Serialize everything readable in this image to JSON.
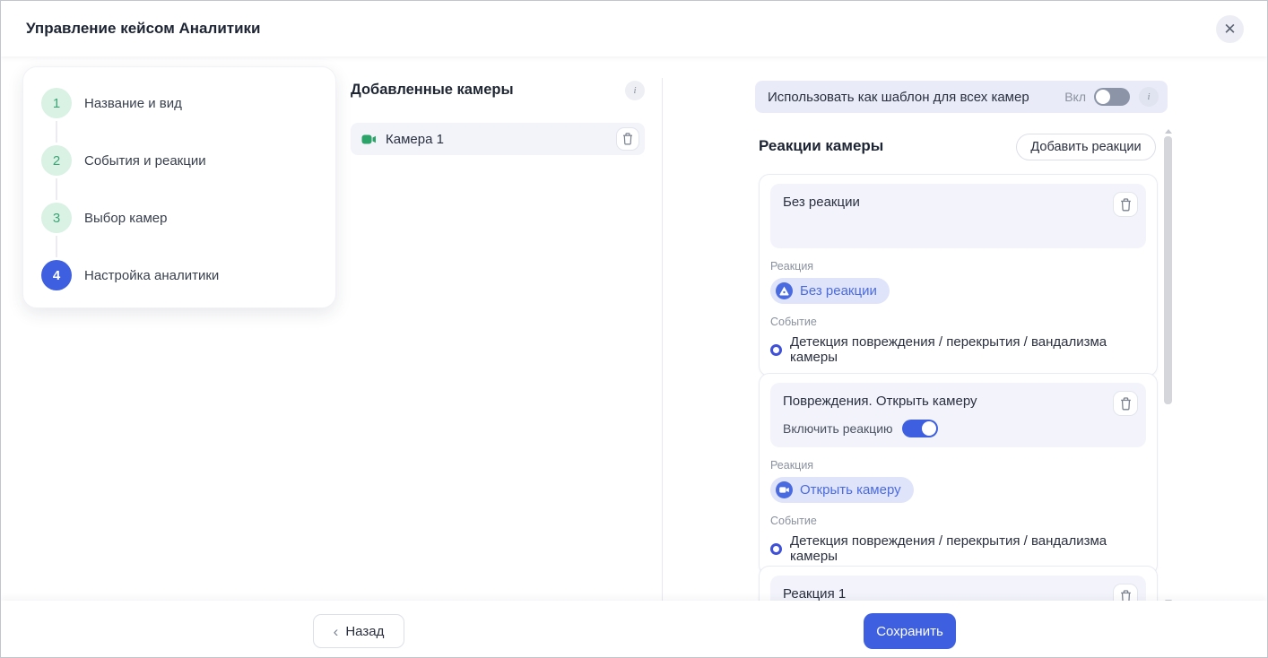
{
  "header": {
    "title": "Управление кейсом Аналитики",
    "close_glyph": "✕"
  },
  "stepper": {
    "steps": [
      {
        "number": "1",
        "label": "Название и вид",
        "state": "done"
      },
      {
        "number": "2",
        "label": "События и реакции",
        "state": "done"
      },
      {
        "number": "3",
        "label": "Выбор камер",
        "state": "done"
      },
      {
        "number": "4",
        "label": "Настройка аналитики",
        "state": "active"
      }
    ]
  },
  "cameras": {
    "title": "Добавленные камеры",
    "info_glyph": "i",
    "items": [
      {
        "name": "Камера 1"
      }
    ]
  },
  "template_bar": {
    "label": "Использовать как шаблон для всех камер",
    "toggle_caption": "Вкл",
    "toggle_state": "off",
    "info_glyph": "i"
  },
  "reactions": {
    "title": "Реакции камеры",
    "add_button_label": "Добавить реакции",
    "reaction_field_label": "Реакция",
    "event_field_label": "Событие",
    "enable_label": "Включить реакцию",
    "cards": [
      {
        "name": "Без реакции",
        "reaction_chip": "Без реакции",
        "chip_icon": "warning-triangle",
        "event": "Детекция повреждения / перекрытия / вандализма камеры"
      },
      {
        "name": "Повреждения. Открыть камеру",
        "enable_toggle_state": "on",
        "reaction_chip": "Открыть камеру",
        "chip_icon": "video-camera",
        "event": "Детекция повреждения / перекрытия / вандализма камеры"
      },
      {
        "name": "Реакция 1"
      }
    ]
  },
  "footer": {
    "back_label": "Назад",
    "back_chevron_glyph": "‹",
    "save_label": "Сохранить"
  },
  "icons": {
    "close": "x-in-circle",
    "info": "i-in-circle",
    "trash": "trash-outline",
    "camera_item": "green-video-camera",
    "event_marker": "blue-radio-ring",
    "scrollbar": "up-down-arrows"
  },
  "colors": {
    "accent_blue": "#3e5fe0",
    "chip_bg": "#dfe4fb",
    "chip_text": "#4a6be0",
    "step_done_bg": "#d9f2e4",
    "step_done_text": "#3fa376",
    "camera_icon_green": "#2ba369",
    "panel_lavender": "#e9ecf8",
    "card_head_bg": "#f3f4fb",
    "muted_text": "#8a919f",
    "dark_text": "#2a3040",
    "toggle_off_track": "#8b95a7"
  }
}
